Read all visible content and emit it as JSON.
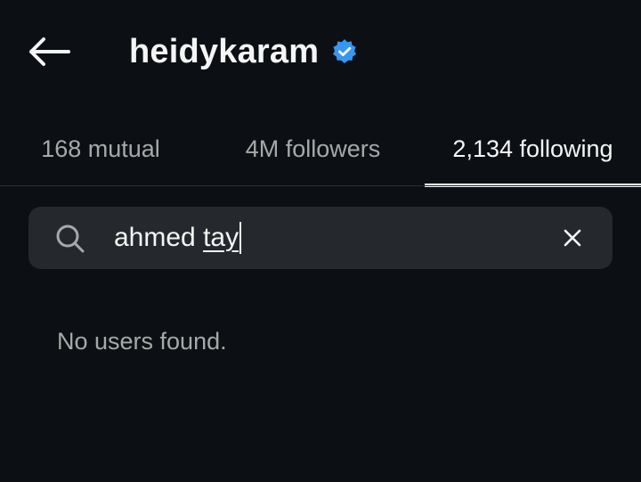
{
  "header": {
    "back_icon": "arrow-left-icon",
    "username": "heidykaram",
    "verified_icon": "verified-badge-icon",
    "verified_color": "#3797f0"
  },
  "tabs": [
    {
      "label": "168 mutual",
      "active": false
    },
    {
      "label": "4M followers",
      "active": false
    },
    {
      "label": "2,134 following",
      "active": true
    }
  ],
  "search": {
    "icon": "search-icon",
    "value_prefix": "ahmed ",
    "value_composing": "tay",
    "clear_icon": "close-icon"
  },
  "results": {
    "empty_message": "No users found."
  }
}
